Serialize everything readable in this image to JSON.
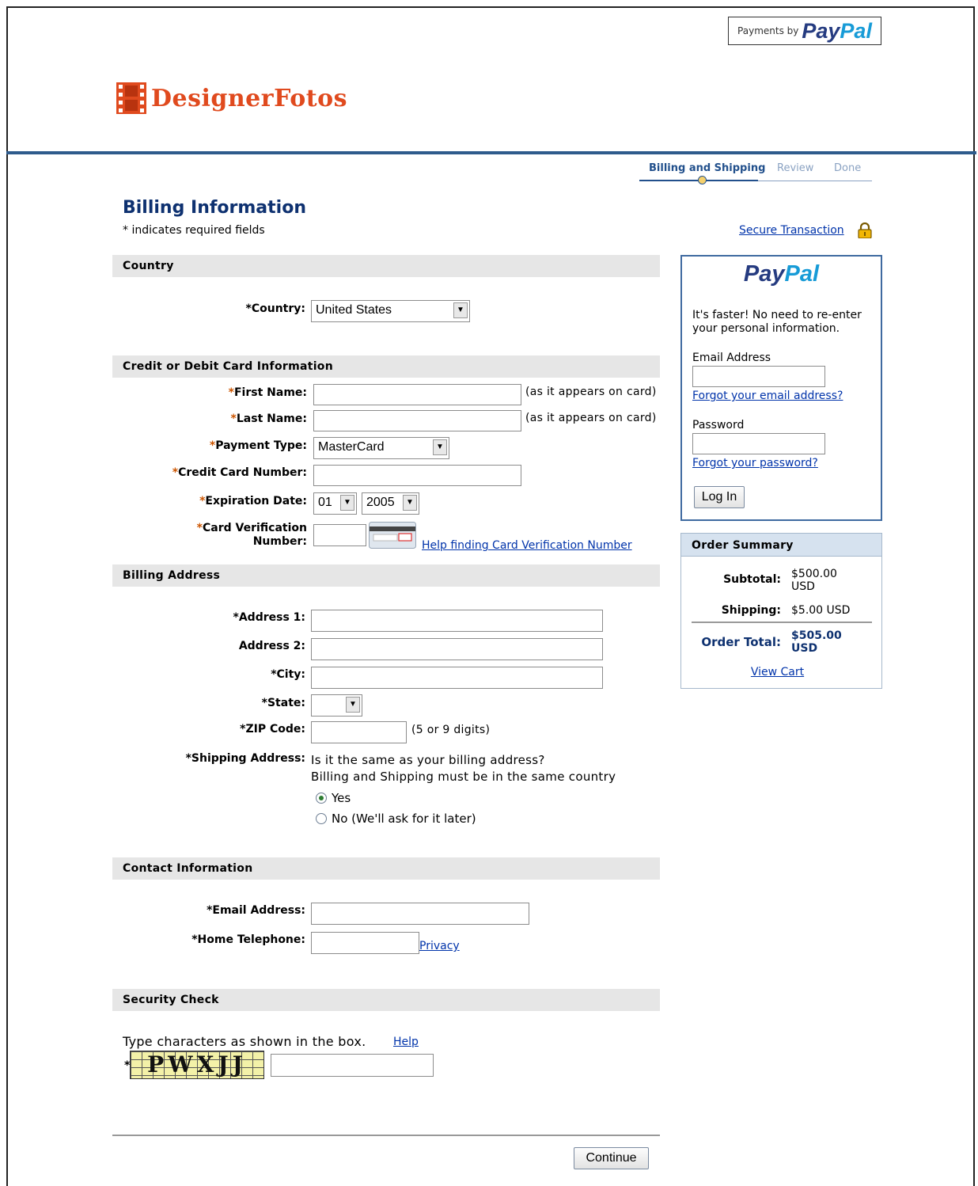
{
  "badge": {
    "prefix": "Payments by",
    "brand_dark": "Pay",
    "brand_light": "Pal"
  },
  "merchant": {
    "name": "DesignerFotos"
  },
  "steps": [
    "Billing and Shipping",
    "Review",
    "Done"
  ],
  "page": {
    "title": "Billing Information",
    "required_note": "* indicates required fields"
  },
  "secure": {
    "label": "Secure Transaction"
  },
  "sections": {
    "country": "Country",
    "card": "Credit or Debit Card Information",
    "billing": "Billing Address",
    "contact": "Contact Information",
    "security": "Security Check"
  },
  "country": {
    "label": "*Country:",
    "value": "United States"
  },
  "card": {
    "first_name_label": "First Name:",
    "last_name_label": "Last Name:",
    "name_note": "(as it appears on card)",
    "payment_type_label": "Payment Type:",
    "payment_type_value": "MasterCard",
    "card_number_label": "Credit Card Number:",
    "expiration_label": "Expiration Date:",
    "exp_month": "01",
    "exp_year": "2005",
    "cvv_label_1": "Card Verification",
    "cvv_label_2": "Number:",
    "cvv_help": "Help finding Card Verification Number"
  },
  "billing": {
    "address1_label": "*Address 1:",
    "address2_label": "Address 2:",
    "city_label": "*City:",
    "state_label": "*State:",
    "zip_label": "*ZIP Code:",
    "zip_note": "(5 or 9 digits)",
    "shipping_label": "*Shipping Address:",
    "shipping_q1": "Is it the same as your billing address?",
    "shipping_q2": "Billing and Shipping must be in the same country",
    "yes": "Yes",
    "no": "No (We'll ask for it later)"
  },
  "contact": {
    "email_label": "*Email Address:",
    "phone_label": "*Home Telephone:",
    "privacy": "Privacy"
  },
  "security": {
    "instruction": "Type characters as shown in the box.",
    "help": "Help",
    "captcha": "PWXJJ"
  },
  "continue": "Continue",
  "login": {
    "brand_dark": "Pay",
    "brand_light": "Pal",
    "intro": "It's faster! No need to re-enter your personal information.",
    "email_label": "Email Address",
    "forgot_email": "Forgot your email address?",
    "password_label": "Password",
    "forgot_password": "Forgot your password?",
    "button": "Log In"
  },
  "summary": {
    "title": "Order Summary",
    "subtotal_label": "Subtotal:",
    "subtotal_value": "$500.00",
    "subtotal_currency": "USD",
    "shipping_label": "Shipping:",
    "shipping_value": "$5.00 USD",
    "total_label": "Order Total:",
    "total_value": "$505.00",
    "total_currency": "USD",
    "view_cart": "View Cart"
  },
  "colors": {
    "brand_orange": "#e04a1e",
    "heading_blue": "#0e3170",
    "link_blue": "#0033aa",
    "paypal_dark": "#253b80",
    "paypal_light": "#179bd7"
  }
}
